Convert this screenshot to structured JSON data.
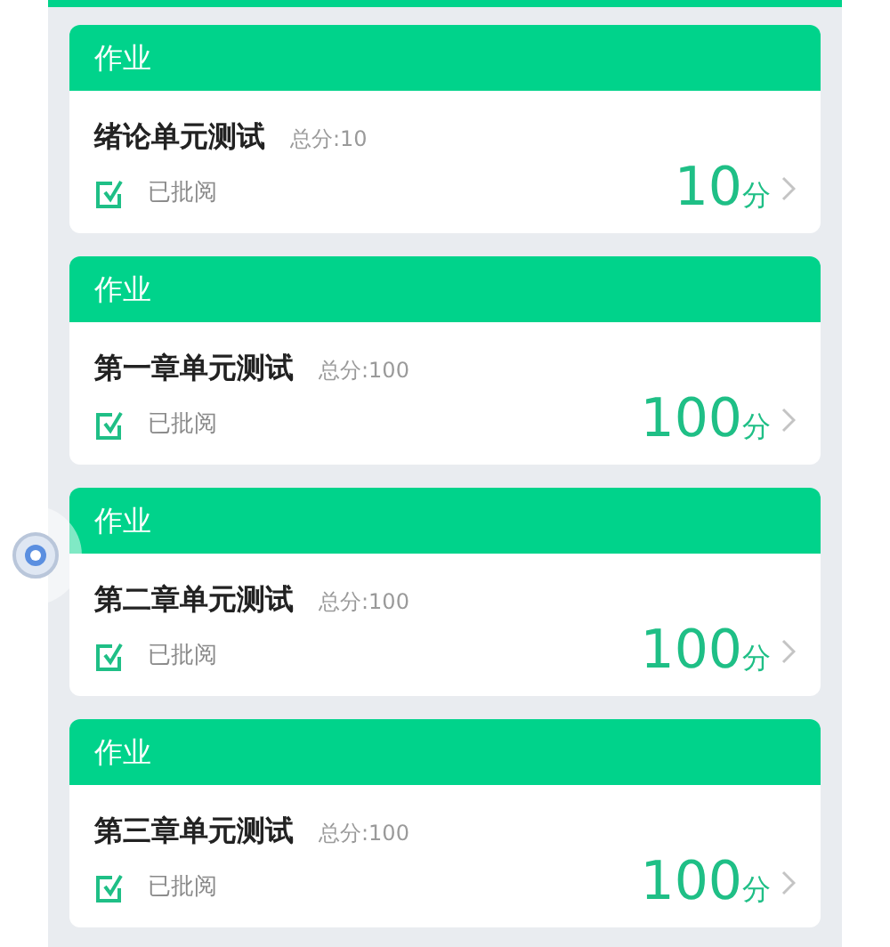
{
  "cards": [
    {
      "header": "作业",
      "title": "绪论单元测试",
      "total": "总分:10",
      "status": "已批阅",
      "score": "10",
      "unit": "分"
    },
    {
      "header": "作业",
      "title": "第一章单元测试",
      "total": "总分:100",
      "status": "已批阅",
      "score": "100",
      "unit": "分"
    },
    {
      "header": "作业",
      "title": "第二章单元测试",
      "total": "总分:100",
      "status": "已批阅",
      "score": "100",
      "unit": "分"
    },
    {
      "header": "作业",
      "title": "第三章单元测试",
      "total": "总分:100",
      "status": "已批阅",
      "score": "100",
      "unit": "分"
    }
  ]
}
